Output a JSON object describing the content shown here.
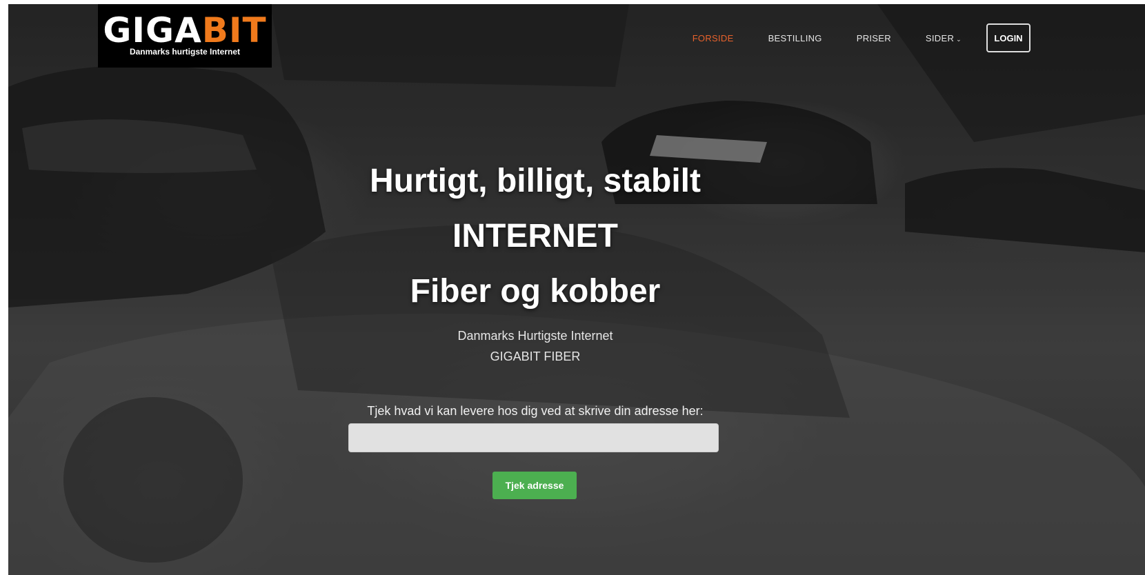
{
  "logo": {
    "part1": "GIGA",
    "part2": "BIT",
    "tagline": "Danmarks hurtigste Internet"
  },
  "nav": {
    "items": [
      {
        "label": "FORSIDE",
        "active": true
      },
      {
        "label": "BESTILLING",
        "active": false
      },
      {
        "label": "PRISER",
        "active": false
      },
      {
        "label": "SIDER",
        "active": false
      }
    ],
    "login": "LOGIN"
  },
  "hero": {
    "line1": "Hurtigt, billigt, stabilt",
    "line2": "INTERNET",
    "line3": "Fiber og kobber",
    "sub1": "Danmarks Hurtigste Internet",
    "sub2": "GIGABIT FIBER"
  },
  "address": {
    "label": "Tjek hvad vi kan levere hos dig ved at skrive din adresse her:",
    "value": "",
    "placeholder": "",
    "button": "Tjek adresse"
  },
  "colors": {
    "accent": "#f07a1c",
    "nav_active": "#e8622c",
    "button": "#4caf50"
  },
  "icons": {
    "dropdown": "chevron-down-icon"
  }
}
